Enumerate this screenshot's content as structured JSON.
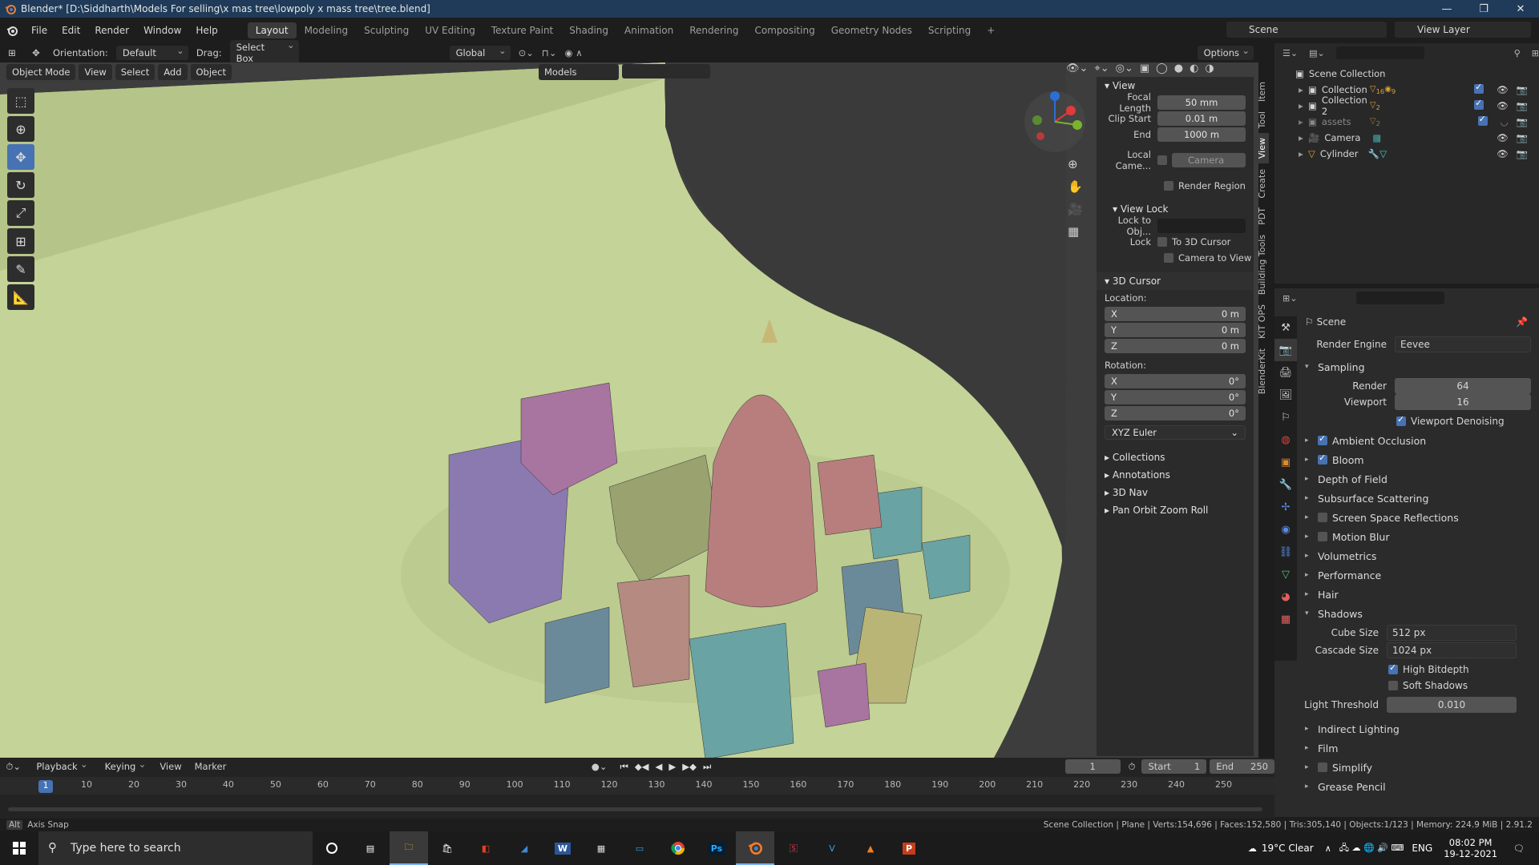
{
  "window": {
    "title": "Blender* [D:\\Siddharth\\Models For selling\\x mas tree\\lowpoly x mass tree\\tree.blend]",
    "min": "—",
    "max": "❐",
    "close": "✕"
  },
  "menu": [
    "File",
    "Edit",
    "Render",
    "Window",
    "Help"
  ],
  "workspaces": [
    "Layout",
    "Modeling",
    "Sculpting",
    "UV Editing",
    "Texture Paint",
    "Shading",
    "Animation",
    "Rendering",
    "Compositing",
    "Geometry Nodes",
    "Scripting"
  ],
  "active_workspace": "Layout",
  "scene": {
    "label": "Scene",
    "view_layer": "View Layer"
  },
  "viewport_header": {
    "orientation_label": "Orientation:",
    "orientation_value": "Default",
    "drag_label": "Drag:",
    "drag_value": "Select Box",
    "transform": "Global",
    "options": "Options"
  },
  "viewport_sub": {
    "mode": "Object Mode",
    "view": "View",
    "select": "Select",
    "add": "Add",
    "object": "Object",
    "models": "Models"
  },
  "npanel": {
    "view_section": "View",
    "focal_length_label": "Focal Length",
    "focal_length": "50 mm",
    "clip_start_label": "Clip Start",
    "clip_start": "0.01 m",
    "end_label": "End",
    "clip_end": "1000 m",
    "local_camera_label": "Local Came...",
    "local_camera_value": "Camera",
    "render_region": "Render Region",
    "view_lock_section": "View Lock",
    "lock_to_obj_label": "Lock to Obj...",
    "lock_label": "Lock",
    "to_3d_cursor": "To 3D Cursor",
    "camera_to_view": "Camera to View",
    "cursor_section": "3D Cursor",
    "location_label": "Location:",
    "loc": [
      {
        "axis": "X",
        "val": "0 m"
      },
      {
        "axis": "Y",
        "val": "0 m"
      },
      {
        "axis": "Z",
        "val": "0 m"
      }
    ],
    "rotation_label": "Rotation:",
    "rot": [
      {
        "axis": "X",
        "val": "0°"
      },
      {
        "axis": "Y",
        "val": "0°"
      },
      {
        "axis": "Z",
        "val": "0°"
      }
    ],
    "rotation_mode": "XYZ Euler",
    "collapsed_sections": [
      "Collections",
      "Annotations",
      "3D Nav",
      "Pan Orbit Zoom Roll"
    ]
  },
  "vtabs": [
    "Item",
    "Tool",
    "View",
    "Create",
    "PDT",
    "Building Tools",
    "KIT OPS",
    "BlenderKit"
  ],
  "outliner": {
    "root": "Scene Collection",
    "items": [
      {
        "name": "Collection",
        "badge": "16",
        "badge2": "9"
      },
      {
        "name": "Collection 2",
        "badge": "2"
      },
      {
        "name": "assets",
        "badge": "2"
      },
      {
        "name": "Camera"
      },
      {
        "name": "Cylinder"
      }
    ]
  },
  "properties": {
    "header": "Scene",
    "render_engine_label": "Render Engine",
    "render_engine": "Eevee",
    "sampling": "Sampling",
    "render_label": "Render",
    "render_samples": "64",
    "viewport_label": "Viewport",
    "viewport_samples": "16",
    "viewport_denoising": "Viewport Denoising",
    "sections": [
      {
        "name": "Ambient Occlusion",
        "checkbox": true,
        "checked": true
      },
      {
        "name": "Bloom",
        "checkbox": true,
        "checked": true
      },
      {
        "name": "Depth of Field",
        "checkbox": false
      },
      {
        "name": "Subsurface Scattering",
        "checkbox": false
      },
      {
        "name": "Screen Space Reflections",
        "checkbox": true,
        "checked": false
      },
      {
        "name": "Motion Blur",
        "checkbox": true,
        "checked": false
      },
      {
        "name": "Volumetrics",
        "checkbox": false
      },
      {
        "name": "Performance",
        "checkbox": false
      },
      {
        "name": "Hair",
        "checkbox": false
      }
    ],
    "shadows": "Shadows",
    "cube_size_label": "Cube Size",
    "cube_size": "512 px",
    "cascade_size_label": "Cascade Size",
    "cascade_size": "1024 px",
    "high_bitdepth": "High Bitdepth",
    "soft_shadows": "Soft Shadows",
    "light_threshold_label": "Light Threshold",
    "light_threshold": "0.010",
    "after_sections": [
      {
        "name": "Indirect Lighting",
        "checkbox": false
      },
      {
        "name": "Film",
        "checkbox": false
      },
      {
        "name": "Simplify",
        "checkbox": true,
        "checked": false
      },
      {
        "name": "Grease Pencil",
        "checkbox": false
      }
    ]
  },
  "timeline": {
    "playback": "Playback",
    "keying": "Keying",
    "view": "View",
    "marker": "Marker",
    "current_frame": "1",
    "start_label": "Start",
    "start": "1",
    "end_label": "End",
    "end": "250",
    "ticks": [
      "1",
      "10",
      "20",
      "30",
      "40",
      "50",
      "60",
      "70",
      "80",
      "90",
      "100",
      "110",
      "120",
      "130",
      "140",
      "150",
      "160",
      "170",
      "180",
      "190",
      "200",
      "210",
      "220",
      "230",
      "240",
      "250"
    ]
  },
  "statusbar": {
    "left": "Axis Snap",
    "right": "Scene Collection | Plane | Verts:154,696 | Faces:152,580 | Tris:305,140 | Objects:1/123 | Memory: 224.9 MiB | 2.91.2"
  },
  "taskbar": {
    "search": "Type here to search",
    "weather": "19°C  Clear",
    "lang": "ENG",
    "time": "08:02 PM",
    "date": "19-12-2021"
  }
}
